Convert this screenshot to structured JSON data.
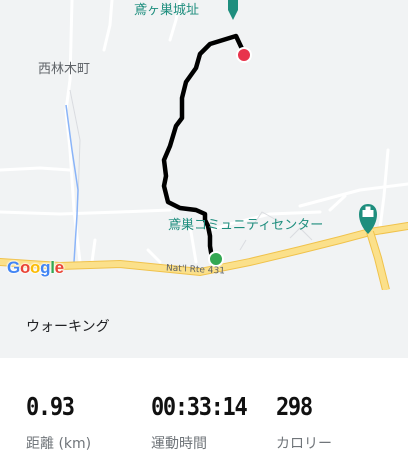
{
  "map": {
    "labels": {
      "castle": "鳶ヶ巣城址",
      "town": "西林木町",
      "community_center": "鳶巣コミュニティセンター",
      "route": "Nat'l Rte 431"
    },
    "brand": [
      "G",
      "o",
      "o",
      "g",
      "l",
      "e"
    ],
    "brand_colors": [
      "#4285F4",
      "#EA4335",
      "#FBBC05",
      "#4285F4",
      "#34A853",
      "#EA4335"
    ],
    "route_color": "#000000",
    "start_marker_color": "#34A853",
    "end_marker_color": "#E8344C",
    "road_major_color": "#fbe08a",
    "poi_color": "#1e8e7e"
  },
  "activity": {
    "type_label": "ウォーキング"
  },
  "stats": [
    {
      "value": "0.93",
      "label": "距離 (km)"
    },
    {
      "value": "00:33:14",
      "label": "運動時間"
    },
    {
      "value": "298",
      "label": "カロリー"
    }
  ]
}
